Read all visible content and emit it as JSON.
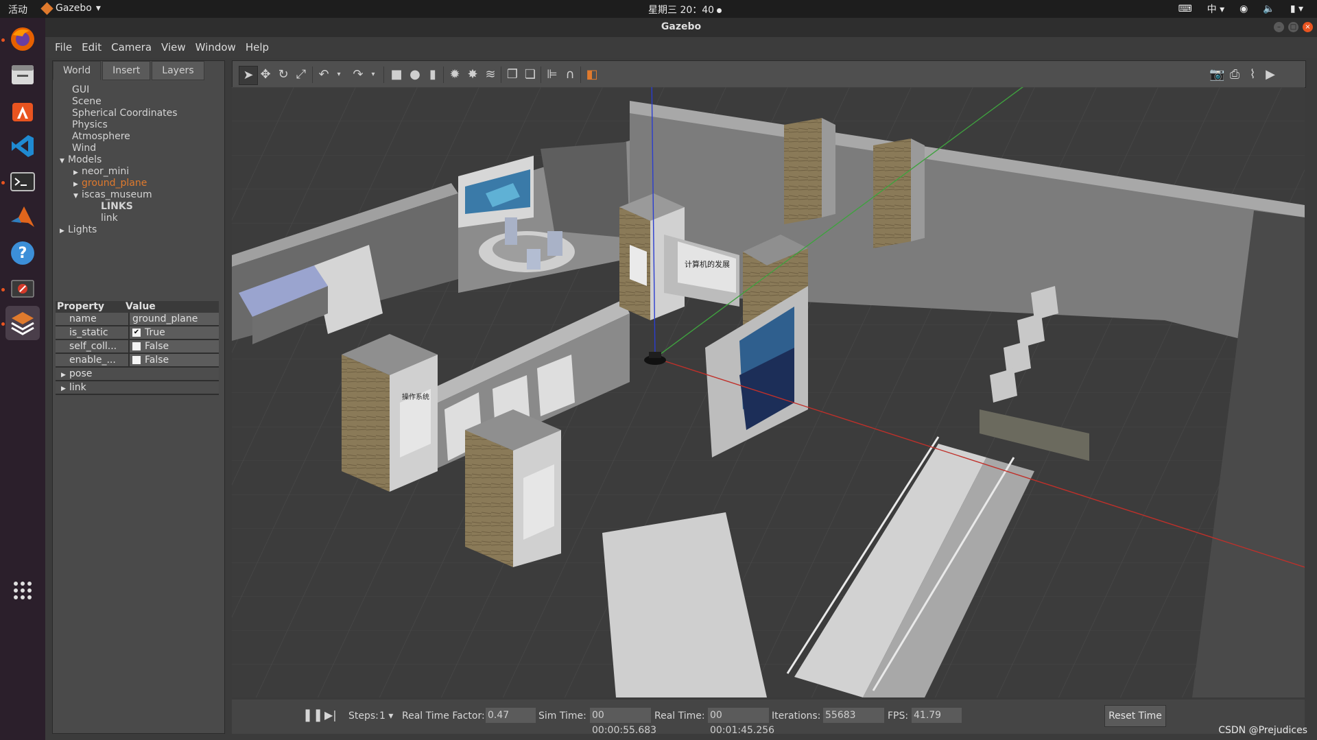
{
  "topbar": {
    "activities": "活动",
    "app_name": "Gazebo",
    "clock": "星期三 20：40",
    "input_method": "中"
  },
  "window": {
    "title": "Gazebo"
  },
  "menu": [
    "File",
    "Edit",
    "Camera",
    "View",
    "Window",
    "Help"
  ],
  "tabs": [
    "World",
    "Insert",
    "Layers"
  ],
  "tree": {
    "gui": "GUI",
    "scene": "Scene",
    "spherical": "Spherical Coordinates",
    "physics": "Physics",
    "atmosphere": "Atmosphere",
    "wind": "Wind",
    "models": "Models",
    "neor_mini": "neor_mini",
    "ground_plane": "ground_plane",
    "iscas_museum": "iscas_museum",
    "links_header": "LINKS",
    "link": "link",
    "lights": "Lights"
  },
  "props": {
    "col_property": "Property",
    "col_value": "Value",
    "name_key": "name",
    "name_val": "ground_plane",
    "static_key": "is_static",
    "static_val": "True",
    "selfcoll_key": "self_coll...",
    "selfcoll_val": "False",
    "enable_key": "enable_...",
    "enable_val": "False",
    "pose": "pose",
    "link": "link"
  },
  "bottom": {
    "steps_label": "Steps:",
    "steps_val": "1",
    "rtf_label": "Real Time Factor:",
    "rtf_val": "0.47",
    "sim_label": "Sim Time:",
    "sim_val": "00 00:00:55.683",
    "real_label": "Real Time:",
    "real_val": "00 00:01:45.256",
    "iter_label": "Iterations:",
    "iter_val": "55683",
    "fps_label": "FPS:",
    "fps_val": "41.79",
    "reset": "Reset Time"
  },
  "watermark": "CSDN @Prejudices",
  "scene_labels": {
    "panel_a": "操作系统",
    "panel_b": "计算机的发展"
  },
  "colors": {
    "accent_orange": "#e07a2d",
    "ubuntu_close": "#e95420",
    "axis_x": "#c0302a",
    "axis_y": "#3fa23f",
    "axis_z": "#2a3dd0"
  }
}
